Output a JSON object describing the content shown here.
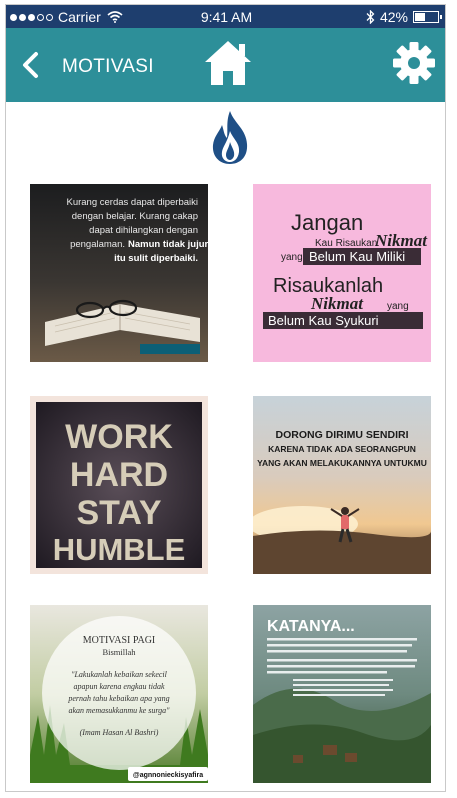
{
  "status_bar": {
    "carrier": "Carrier",
    "time": "9:41 AM",
    "battery": "42%"
  },
  "nav": {
    "title": "MOTIVASI"
  },
  "icons": {
    "back": "chevron-left-icon",
    "home": "home-icon",
    "settings": "gear-icon",
    "flame": "flame-icon"
  },
  "colors": {
    "status_bar": "#1e3e6e",
    "nav_bar": "#2d8f99",
    "flame": "#1f4f86"
  },
  "images": [
    {
      "lines": [
        "Kurang cerdas dapat diperbaiki",
        "dengan belajar. Kurang cakap",
        "dapat dihilangkan dengan",
        "pengalaman.",
        "Namun tidak jujur",
        "itu sulit diperbaiki."
      ]
    },
    {
      "lines": [
        "Jangan",
        "Kau Risaukan",
        "Nikmat",
        "yang",
        "Belum Kau Miliki",
        "Risaukanlah",
        "Nikmat",
        "yang",
        "Belum Kau Syukuri"
      ]
    },
    {
      "lines": [
        "WORK",
        "HARD",
        "STAY",
        "HUMBLE"
      ]
    },
    {
      "lines": [
        "DORONG DIRIMU SENDIRI",
        "KARENA TIDAK ADA SEORANGPUN",
        "YANG AKAN MELAKUKANNYA UNTUKMU"
      ]
    },
    {
      "lines": [
        "MOTIVASI PAGI",
        "Bismillah",
        "\"Lakukanlah kebaikan sekecil",
        "apapun karena engkau tidak",
        "pernah tahu kebaikan apa yang",
        "akan memasukkanmu ke surga\"",
        "(Imam Hasan Al Bashri)",
        "@agnnonieckisyafira"
      ]
    },
    {
      "lines": [
        "KATANYA..."
      ]
    }
  ]
}
